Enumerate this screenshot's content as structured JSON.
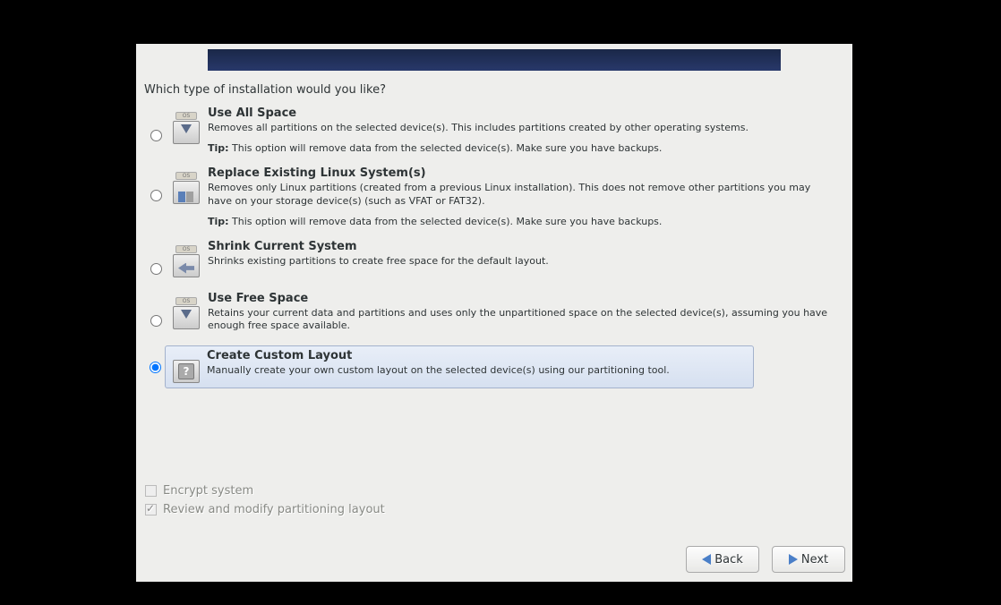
{
  "prompt": "Which type of installation would you like?",
  "options": [
    {
      "title": "Use All Space",
      "desc": "Removes all partitions on the selected device(s).  This includes partitions created by other operating systems.",
      "tip_label": "Tip:",
      "tip_text": " This option will remove data from the selected device(s).  Make sure you have backups.",
      "selected": false
    },
    {
      "title": "Replace Existing Linux System(s)",
      "desc": "Removes only Linux partitions (created from a previous Linux installation).  This does not remove other partitions you may have on your storage device(s) (such as VFAT or FAT32).",
      "tip_label": "Tip:",
      "tip_text": " This option will remove data from the selected device(s).  Make sure you have backups.",
      "selected": false
    },
    {
      "title": "Shrink Current System",
      "desc": "Shrinks existing partitions to create free space for the default layout.",
      "selected": false
    },
    {
      "title": "Use Free Space",
      "desc": "Retains your current data and partitions and uses only the unpartitioned space on the selected device(s), assuming you have enough free space available.",
      "selected": false
    },
    {
      "title": "Create Custom Layout",
      "desc": "Manually create your own custom layout on the selected device(s) using our partitioning tool.",
      "selected": true
    }
  ],
  "checkboxes": {
    "encrypt": {
      "label": "Encrypt system",
      "checked": false,
      "disabled": true
    },
    "review": {
      "label": "Review and modify partitioning layout",
      "checked": true,
      "disabled": true
    }
  },
  "buttons": {
    "back": "Back",
    "next": "Next"
  },
  "icons": {
    "os_label": "OS",
    "q": "?"
  }
}
